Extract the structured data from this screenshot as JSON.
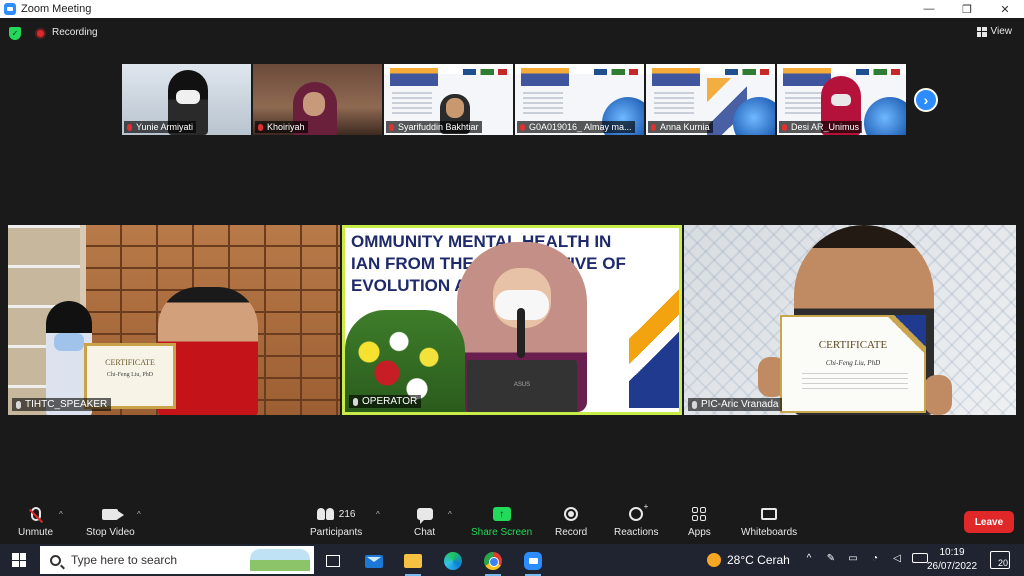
{
  "window": {
    "title": "Zoom Meeting",
    "controls": {
      "minimize": "—",
      "restore": "❐",
      "close": "✕"
    }
  },
  "topbar": {
    "recording_label": "Recording",
    "view_label": "View"
  },
  "thumbnails": [
    {
      "name": "Yunie Armiyati"
    },
    {
      "name": "Khoiriyah"
    },
    {
      "name": "Syarifuddin Bakhtiar"
    },
    {
      "name": "G0A019016_ Almay ma..."
    },
    {
      "name": "Anna Kurnia"
    },
    {
      "name": "Desi AR_Unimus"
    }
  ],
  "tiles": {
    "left": {
      "name": "TIHTC_SPEAKER",
      "cert_title": "CERTIFICATE",
      "cert_name": "Chi-Feng Liu, PhD"
    },
    "center": {
      "name": "OPERATOR",
      "banner_lines": [
        "OMMUNITY MENTAL HEALTH IN",
        "IAN FROM THE PERSPECTIVE OF",
        "EVOLUTION AND PRACTICE"
      ],
      "laptop_brand": "ASUS"
    },
    "right": {
      "name": "PIC-Aric Vranada",
      "cert_title": "CERTIFICATE",
      "cert_name": "Chi-Feng Liu, PhD"
    }
  },
  "toolbar": {
    "unmute": "Unmute",
    "stop_video": "Stop Video",
    "participants": "Participants",
    "participants_count": "216",
    "chat": "Chat",
    "share_screen": "Share Screen",
    "record": "Record",
    "reactions": "Reactions",
    "apps": "Apps",
    "whiteboards": "Whiteboards",
    "leave": "Leave"
  },
  "taskbar": {
    "search_placeholder": "Type here to search",
    "weather": "28°C  Cerah",
    "time": "10:19",
    "date": "26/07/2022",
    "notifications": "20"
  },
  "colors": {
    "zoom_blue": "#2d8cff",
    "share_green": "#23d959",
    "leave_red": "#e02828",
    "active_speaker": "#c9ec4b"
  }
}
